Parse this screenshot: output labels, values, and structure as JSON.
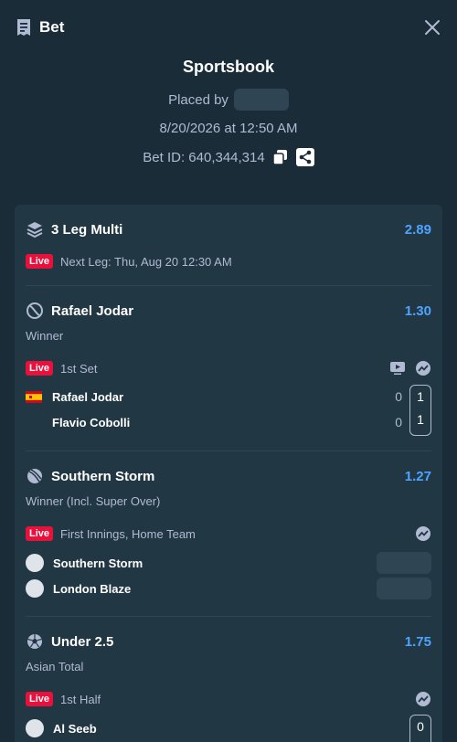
{
  "header": {
    "title": "Bet"
  },
  "summary": {
    "source": "Sportsbook",
    "placed_by_label": "Placed by",
    "datetime": "8/20/2026 at 12:50 AM",
    "bet_id": "Bet ID: 640,344,314"
  },
  "multi": {
    "title": "3 Leg Multi",
    "odds": "2.89",
    "live_label": "Live",
    "next_leg": "Next Leg: Thu, Aug 20 12:30 AM"
  },
  "legs": [
    {
      "selection": "Rafael Jodar",
      "odds": "1.30",
      "market": "Winner",
      "live_label": "Live",
      "status": "1st Set",
      "teams": [
        {
          "name": "Rafael Jodar",
          "game": "0",
          "set": "1"
        },
        {
          "name": "Flavio Cobolli",
          "game": "0",
          "set": "1"
        }
      ]
    },
    {
      "selection": "Southern Storm",
      "odds": "1.27",
      "market": "Winner (Incl. Super Over)",
      "live_label": "Live",
      "status": "First Innings, Home Team",
      "teams": [
        {
          "name": "Southern Storm"
        },
        {
          "name": "London Blaze"
        }
      ]
    },
    {
      "selection": "Under 2.5",
      "odds": "1.75",
      "market": "Asian Total",
      "live_label": "Live",
      "status": "1st Half",
      "teams": [
        {
          "name": "Al Seeb",
          "score": "0"
        }
      ]
    }
  ],
  "colors": {
    "background": "#1a2c38",
    "card": "#213743",
    "odds": "#4ea3ff",
    "live": "#e9113c"
  }
}
